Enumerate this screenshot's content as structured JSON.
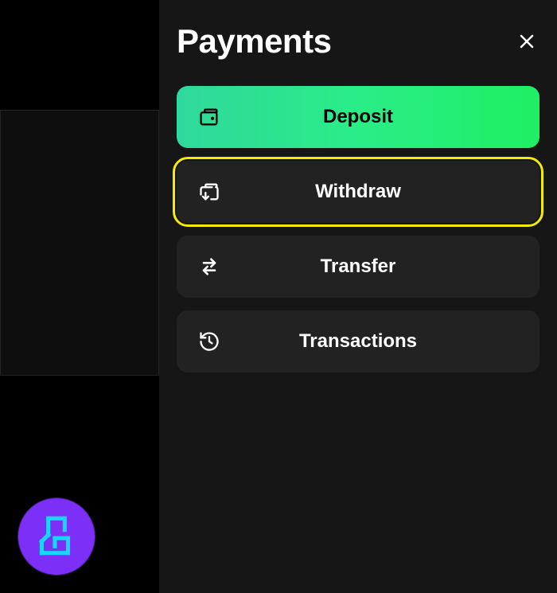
{
  "panel": {
    "title": "Payments",
    "items": [
      {
        "label": "Deposit",
        "style": "gradient",
        "highlighted": false
      },
      {
        "label": "Withdraw",
        "style": "dark",
        "highlighted": true
      },
      {
        "label": "Transfer",
        "style": "dark",
        "highlighted": false
      },
      {
        "label": "Transactions",
        "style": "dark",
        "highlighted": false
      }
    ]
  }
}
